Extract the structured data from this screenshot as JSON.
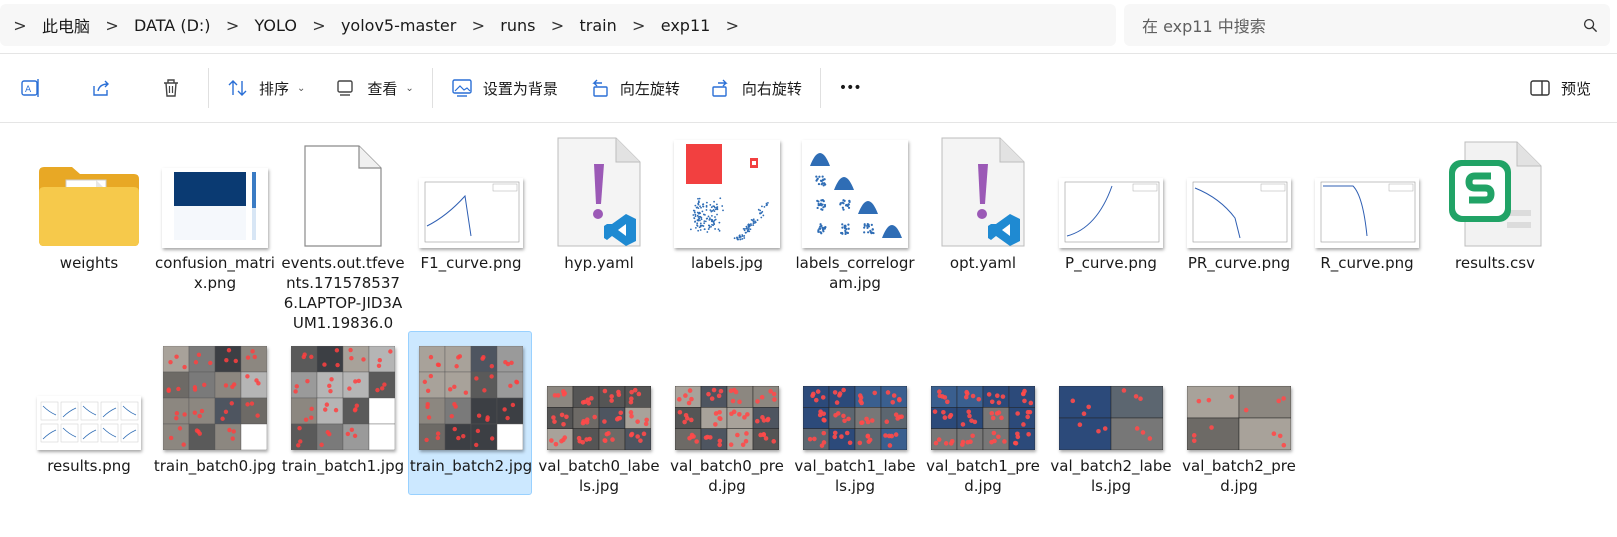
{
  "breadcrumb": {
    "separator": ">",
    "items": [
      "此电脑",
      "DATA (D:)",
      "YOLO",
      "yolov5-master",
      "runs",
      "train",
      "exp11"
    ]
  },
  "search": {
    "placeholder": "在 exp11 中搜索",
    "icon": "search-icon"
  },
  "toolbar": {
    "rename_icon": "rename-icon",
    "share_icon": "share-icon",
    "delete_icon": "delete-icon",
    "sort_label": "排序",
    "view_label": "查看",
    "set_background_label": "设置为背景",
    "rotate_left_label": "向左旋转",
    "rotate_right_label": "向右旋转",
    "more_label": "•••",
    "preview_label": "预览"
  },
  "files": [
    {
      "name": "weights",
      "kind": "folder"
    },
    {
      "name": "confusion_matrix.png",
      "kind": "image-matrix"
    },
    {
      "name": "events.out.tfevents.1715785376.LAPTOP-JID3AUM1.19836.0",
      "kind": "blank-file"
    },
    {
      "name": "F1_curve.png",
      "kind": "image-curve"
    },
    {
      "name": "hyp.yaml",
      "kind": "yaml"
    },
    {
      "name": "labels.jpg",
      "kind": "image-labels"
    },
    {
      "name": "labels_correlogram.jpg",
      "kind": "image-correlogram"
    },
    {
      "name": "opt.yaml",
      "kind": "yaml"
    },
    {
      "name": "P_curve.png",
      "kind": "image-curve"
    },
    {
      "name": "PR_curve.png",
      "kind": "image-curve"
    },
    {
      "name": "R_curve.png",
      "kind": "image-curve"
    },
    {
      "name": "results.csv",
      "kind": "csv"
    },
    {
      "name": "results.png",
      "kind": "image-results"
    },
    {
      "name": "train_batch0.jpg",
      "kind": "image-batch"
    },
    {
      "name": "train_batch1.jpg",
      "kind": "image-batch"
    },
    {
      "name": "train_batch2.jpg",
      "kind": "image-batch",
      "selected": true
    },
    {
      "name": "val_batch0_labels.jpg",
      "kind": "image-val"
    },
    {
      "name": "val_batch0_pred.jpg",
      "kind": "image-val"
    },
    {
      "name": "val_batch1_labels.jpg",
      "kind": "image-val"
    },
    {
      "name": "val_batch1_pred.jpg",
      "kind": "image-val"
    },
    {
      "name": "val_batch2_labels.jpg",
      "kind": "image-val"
    },
    {
      "name": "val_batch2_pred.jpg",
      "kind": "image-val"
    }
  ],
  "colors": {
    "selection": "#cce8ff",
    "selection_border": "#99d1ff",
    "folder": "#f4c542",
    "vscode_blue": "#1f8ad2",
    "yaml_purple": "#9b59b6",
    "csv_green": "#21a366"
  }
}
